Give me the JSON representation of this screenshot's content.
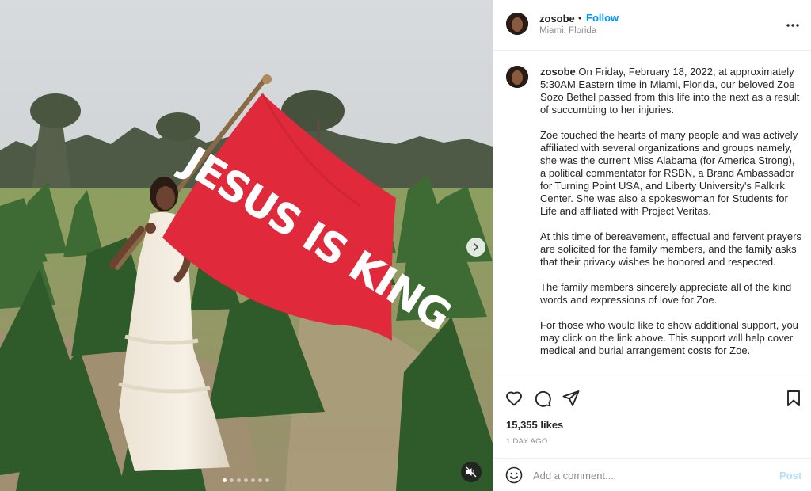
{
  "post": {
    "username": "zosobe",
    "separator": "•",
    "follow_label": "Follow",
    "location": "Miami, Florida",
    "more_icon": "more-horizontal-icon",
    "media": {
      "flag_text": "JESUS IS KING",
      "flag_color": "#e02a3b",
      "carousel_total": 7,
      "carousel_active": 1
    },
    "caption": {
      "username": "zosobe",
      "paragraphs": [
        "On Friday, February 18, 2022, at approximately 5:30AM Eastern time in Miami, Florida, our beloved Zoe Sozo Bethel passed from this life into the next as a result of succumbing to her injuries.",
        "Zoe touched the hearts of many people and was actively affiliated with several organizations and groups namely, she was the current Miss Alabama (for America Strong), a political commentator for RSBN, a Brand Ambassador for Turning Point USA, and Liberty University's Falkirk Center. She was also a spokeswoman for Students for Life and affiliated with Project Veritas.",
        "At this time of bereavement, effectual and fervent prayers are solicited for the family members, and the family asks that their privacy wishes be honored and respected.",
        "The family members sincerely appreciate all of the kind words and expressions of love for Zoe.",
        "For those who would like to show additional support, you may click on the link above. This support will help cover medical and burial arrangement costs for Zoe."
      ]
    },
    "likes": "15,355 likes",
    "time_ago": "1 DAY AGO",
    "comment": {
      "placeholder": "Add a comment...",
      "post_label": "Post"
    },
    "colors": {
      "accent": "#0095f6",
      "post_disabled": "#b2dffc",
      "secondary_text": "#8e8e8e"
    }
  }
}
